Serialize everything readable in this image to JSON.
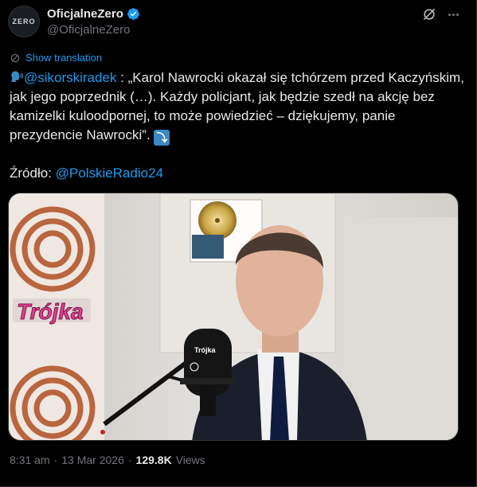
{
  "author": {
    "avatar_text": "ZERO",
    "display_name": "OficjalneZero",
    "handle": "@OficjalneZero"
  },
  "translate_label": "Show translation",
  "post": {
    "mention": "@sikorskiradek",
    "text": " : „Karol Nawrocki okazał się tchórzem przed Kaczyńskim, jak jego poprzednik (…). Każdy policjant, jak będzie szedł na akcję bez kamizelki kuloodpornej, to może powiedzieć – dziękujemy, panie prezydencie Nawrocki”.",
    "source_label": "Źródło: ",
    "source_link": "@PolskieRadio24"
  },
  "media": {
    "overlay_logo": "Trójka",
    "mic_logo": "Trójka"
  },
  "meta": {
    "time": "8:31 am",
    "separator": "·",
    "date": "13 Mar 2026",
    "views_count": "129.8K",
    "views_label": "Views"
  },
  "colors": {
    "accent": "#1d9bf0",
    "verified": "#1d9bf0",
    "text": "#e7e9ea",
    "muted": "#71767b",
    "background": "#000000"
  },
  "icons": [
    "verified-badge-icon",
    "grok-icon",
    "more-icon",
    "translate-icon",
    "speaking-head-icon",
    "arrow-down-icon"
  ]
}
